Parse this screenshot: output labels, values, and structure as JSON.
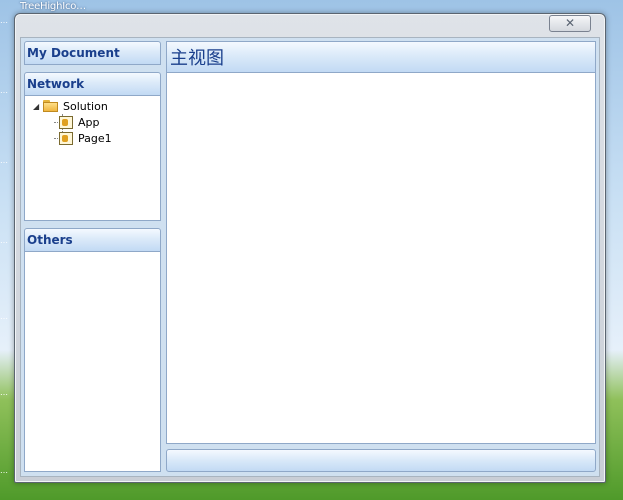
{
  "background": {
    "caption": "TreeHighIco…",
    "edge_marks": [
      "…",
      "…",
      "…",
      "…",
      "…",
      "…",
      "…"
    ]
  },
  "window": {
    "close_glyph": "✕"
  },
  "sidebar": {
    "sections": [
      {
        "label": "My Document"
      },
      {
        "label": "Network"
      },
      {
        "label": "Others"
      }
    ],
    "tree": {
      "root": {
        "expander": "◢",
        "label": "Solution"
      },
      "children": [
        {
          "label": "App"
        },
        {
          "label": "Page1"
        }
      ]
    }
  },
  "main": {
    "title": "主视图"
  },
  "colors": {
    "header_text": "#1a3f8c",
    "panel_border": "#8fa8c8"
  }
}
